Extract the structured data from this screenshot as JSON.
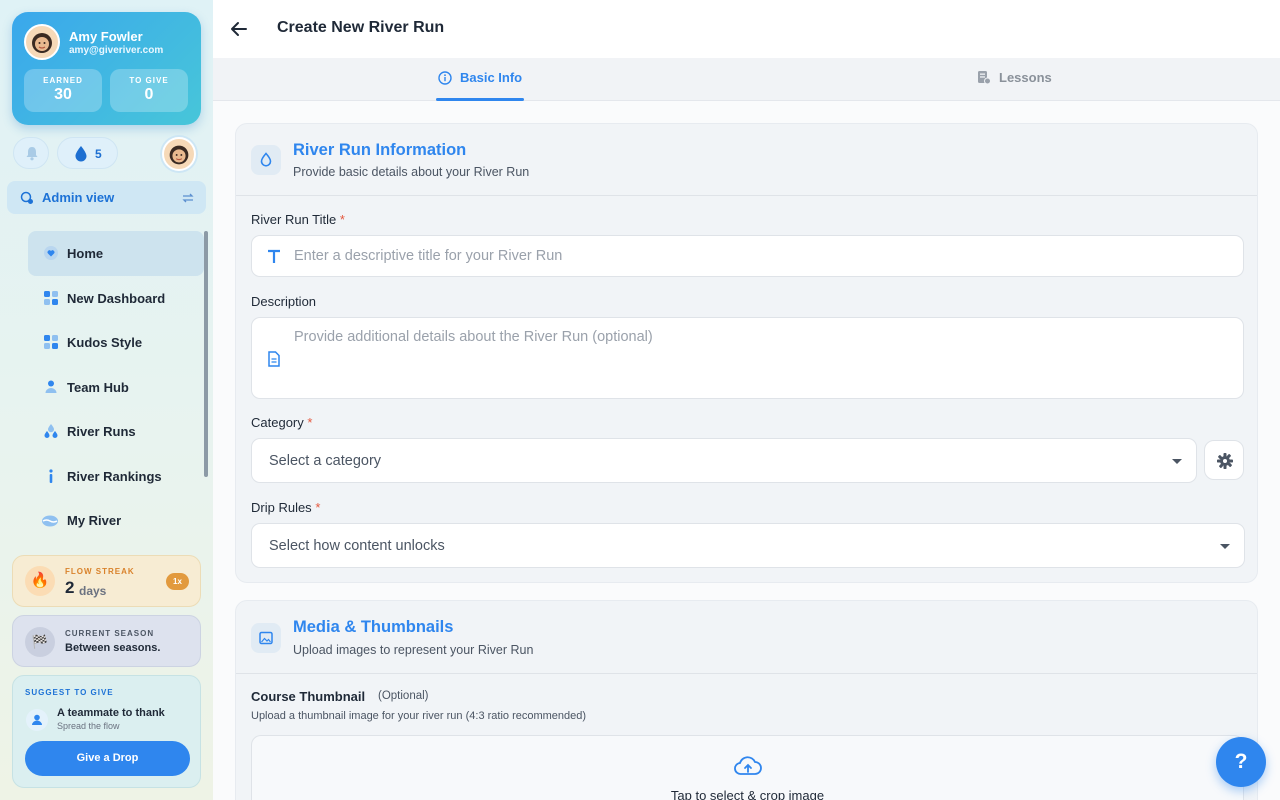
{
  "profile": {
    "name": "Amy Fowler",
    "email": "amy@giveriver.com",
    "earned_label": "EARNED",
    "earned_value": "30",
    "to_give_label": "TO GIVE",
    "to_give_value": "0"
  },
  "quick": {
    "drops_count": "5"
  },
  "admin": {
    "label": "Admin view"
  },
  "nav": {
    "items": [
      {
        "label": "Home",
        "icon": "heart-drop-icon",
        "active": true
      },
      {
        "label": "New Dashboard",
        "icon": "dashboard-grid-icon"
      },
      {
        "label": "Kudos Style",
        "icon": "dashboard-grid-icon"
      },
      {
        "label": "Team Hub",
        "icon": "team-icon"
      },
      {
        "label": "River Runs",
        "icon": "drops-icon"
      },
      {
        "label": "River Rankings",
        "icon": "info-icon"
      },
      {
        "label": "My River",
        "icon": "river-icon"
      }
    ]
  },
  "streak": {
    "label": "FLOW STREAK",
    "value": "2",
    "unit": "days",
    "badge": "1x"
  },
  "season": {
    "label": "CURRENT SEASON",
    "value": "Between seasons."
  },
  "suggest": {
    "label": "SUGGEST TO GIVE",
    "title": "A teammate to thank",
    "subtitle": "Spread the flow",
    "button": "Give a Drop"
  },
  "header": {
    "title": "Create New River Run"
  },
  "tabs": [
    {
      "label": "Basic Info",
      "active": true
    },
    {
      "label": "Lessons",
      "active": false
    }
  ],
  "info_card": {
    "title": "River Run Information",
    "subtitle": "Provide basic details about your River Run",
    "title_field": {
      "label": "River Run Title",
      "required": "*",
      "placeholder": "Enter a descriptive title for your River Run"
    },
    "description_field": {
      "label": "Description",
      "placeholder": "Provide additional details about the River Run (optional)"
    },
    "category_field": {
      "label": "Category",
      "required": "*",
      "placeholder": "Select a category"
    },
    "drip_field": {
      "label": "Drip Rules",
      "required": "*",
      "placeholder": "Select how content unlocks"
    }
  },
  "media_card": {
    "title": "Media & Thumbnails",
    "subtitle": "Upload images to represent your River Run",
    "thumb_label": "Course Thumbnail",
    "thumb_optional": "(Optional)",
    "thumb_help": "Upload a thumbnail image for your river run (4:3 ratio recommended)",
    "dropzone_text": "Tap to select & crop image"
  },
  "help": {
    "label": "?"
  },
  "colors": {
    "accent": "#2f86ee",
    "required": "#e4573d"
  }
}
